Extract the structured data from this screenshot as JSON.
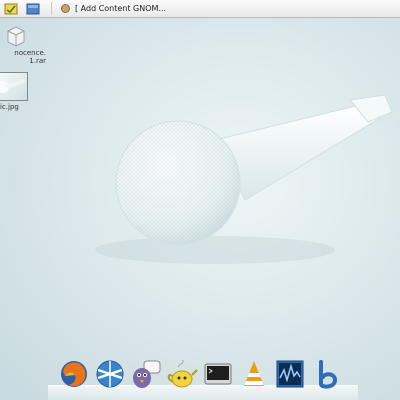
{
  "top_panel": {
    "window_task": {
      "label": "[ Add Content GNOM..."
    }
  },
  "desktop_icons": [
    {
      "name": "rar-archive",
      "label_line1": "nocence.",
      "label_line2": "1.rar"
    },
    {
      "name": "jpg-image",
      "label": "ic.jpg"
    }
  ],
  "dock": {
    "items": [
      "firefox-icon",
      "network-globe-icon",
      "chat-bird-icon",
      "tea-pot-icon",
      "terminal-icon",
      "vlc-icon",
      "system-monitor-icon",
      "blue-b-icon"
    ]
  },
  "colors": {
    "wallpaper": "#dde9ec",
    "panel": "#efefef"
  }
}
